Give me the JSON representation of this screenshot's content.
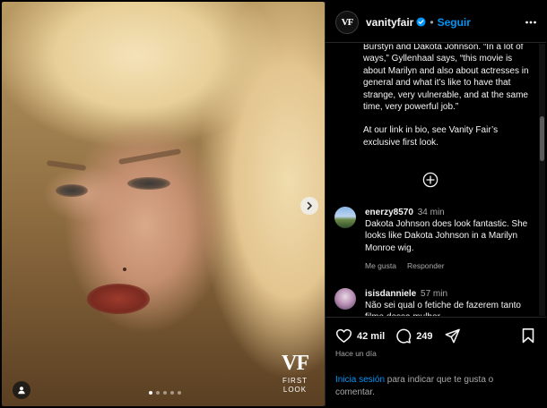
{
  "photo": {
    "watermark_logo": "VF",
    "watermark_lines": [
      "FIRST",
      "LOOK"
    ],
    "carousel_slides": 5,
    "active_slide": 1
  },
  "header": {
    "avatar_text": "VF",
    "username": "vanityfair",
    "separator": "•",
    "follow_label": "Seguir"
  },
  "caption": {
    "paragraph1": "Burstyn and Dakota Johnson. “In a lot of ways,” Gyllenhaal says, “this movie is about Marilyn and also about actresses in general and what it’s like to have that strange, very vulnerable, and at the same time, very powerful job.”",
    "paragraph2": "At our link in bio, see Vanity Fair’s exclusive first look."
  },
  "comments": [
    {
      "username": "enerzy8570",
      "time": "34 min",
      "text": "Dakota Johnson does look fantastic. She looks like Dakota Johnson in a Marilyn Monroe wig.",
      "like_label": "Me gusta",
      "reply_label": "Responder"
    },
    {
      "username": "isisdanniele",
      "time": "57 min",
      "text": "Não sei qual o fetiche de fazerem tanto filme dessa mulher"
    }
  ],
  "footer": {
    "likes": "42 mil",
    "comments_count": "249",
    "date": "Hace un día",
    "login_link": "Inicia sesión",
    "login_text": " para indicar que te gusta o comentar."
  },
  "colors": {
    "background": "#000000",
    "accent": "#0095f6",
    "muted": "#a8a8a8",
    "divider": "#262626"
  },
  "icons": [
    "chevron-right-icon",
    "user-tag-icon",
    "verified-badge-icon",
    "more-options-icon",
    "load-more-comments-icon",
    "heart-icon",
    "comment-icon",
    "share-icon",
    "bookmark-icon"
  ]
}
